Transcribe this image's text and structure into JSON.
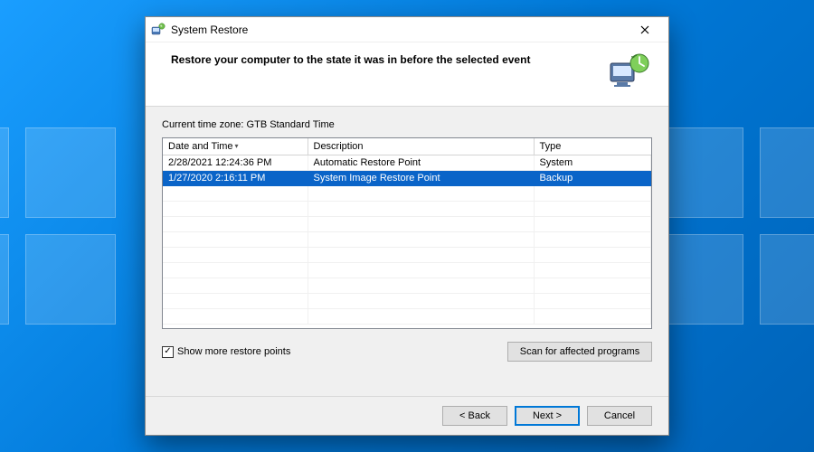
{
  "window": {
    "title": "System Restore"
  },
  "header": {
    "heading": "Restore your computer to the state it was in before the selected event"
  },
  "timezone": {
    "label": "Current time zone: GTB Standard Time"
  },
  "table": {
    "columns": {
      "date": "Date and Time",
      "description": "Description",
      "type": "Type"
    },
    "rows": [
      {
        "date": "2/28/2021 12:24:36 PM",
        "description": "Automatic Restore Point",
        "type": "System",
        "selected": false
      },
      {
        "date": "1/27/2020 2:16:11 PM",
        "description": "System Image Restore Point",
        "type": "Backup",
        "selected": true
      }
    ]
  },
  "checkbox": {
    "show_more_label": "Show more restore points",
    "checked": true
  },
  "buttons": {
    "scan": "Scan for affected programs",
    "back": "< Back",
    "next": "Next >",
    "cancel": "Cancel"
  }
}
